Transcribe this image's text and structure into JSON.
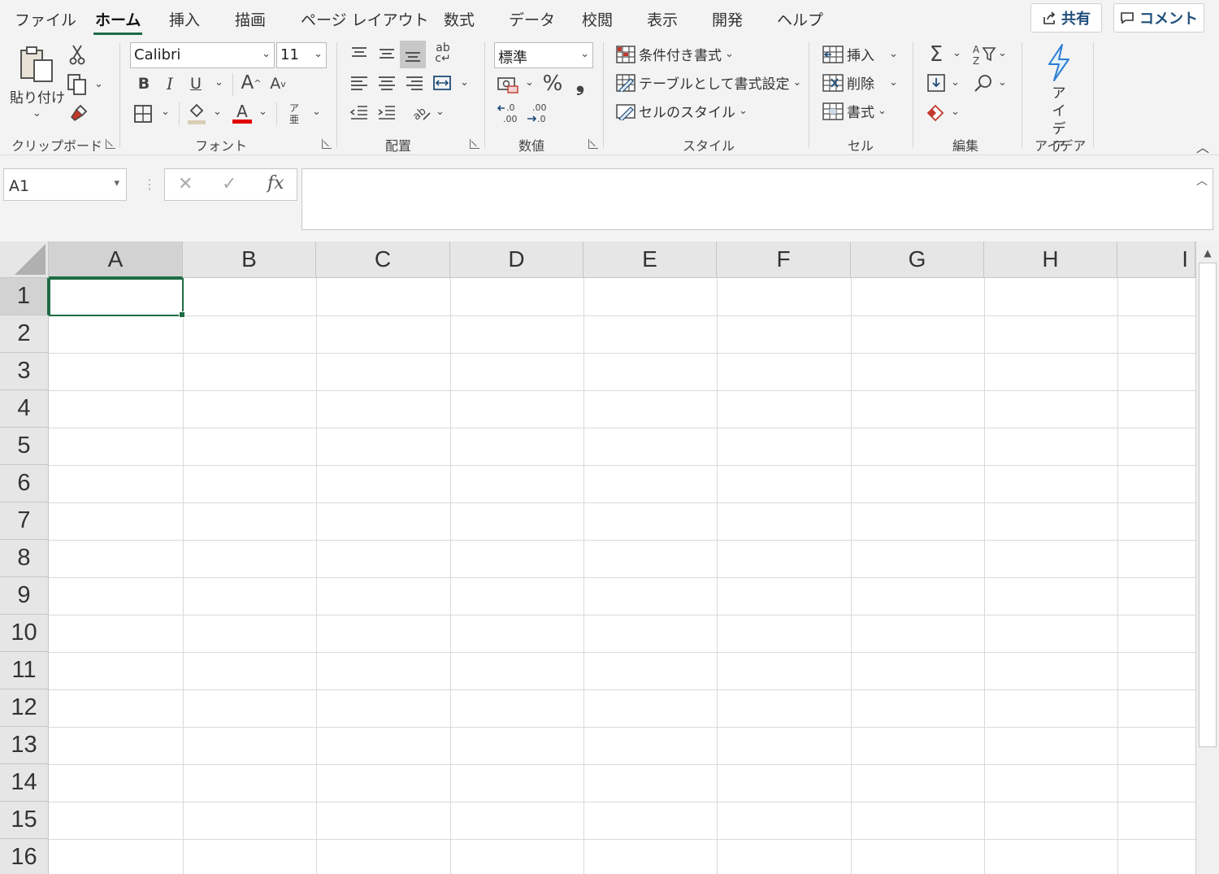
{
  "menu": {
    "tabs": [
      "ファイル",
      "ホーム",
      "挿入",
      "描画",
      "ページ レイアウト",
      "数式",
      "データ",
      "校閲",
      "表示",
      "開発",
      "ヘルプ"
    ],
    "active": "ホーム",
    "share_label": "共有",
    "comment_label": "コメント"
  },
  "ribbon": {
    "clipboard": {
      "paste_label": "貼り付け",
      "group_label": "クリップボード"
    },
    "font": {
      "font_name": "Calibri",
      "font_size": "11",
      "bold": "B",
      "italic": "I",
      "underline": "U",
      "grow": "A",
      "shrink": "A",
      "font_color_glyph": "A",
      "phonetic_top": "ア",
      "phonetic_bottom": "亜",
      "group_label": "フォント"
    },
    "alignment": {
      "group_label": "配置"
    },
    "number": {
      "format": "標準",
      "percent": "%",
      "comma": "❟",
      "inc_decimal": ".0​.00",
      "group_label": "数値"
    },
    "styles": {
      "conditional": "条件付き書式",
      "table": "テーブルとして書式設定",
      "cell_styles": "セルのスタイル",
      "group_label": "スタイル"
    },
    "cells": {
      "insert": "挿入",
      "delete": "削除",
      "format": "書式",
      "group_label": "セル"
    },
    "editing": {
      "group_label": "編集"
    },
    "ideas": {
      "label_line1": "アイ",
      "label_line2": "デア",
      "group_label": "アイデア"
    }
  },
  "formula_bar": {
    "name_box": "A1",
    "fx": "fx",
    "formula": ""
  },
  "grid": {
    "columns": [
      "A",
      "B",
      "C",
      "D",
      "E",
      "F",
      "G",
      "H",
      "I"
    ],
    "rows": [
      "1",
      "2",
      "3",
      "4",
      "5",
      "6",
      "7",
      "8",
      "9",
      "10",
      "11",
      "12",
      "13",
      "14",
      "15",
      "16"
    ],
    "selected_cell": "A1"
  }
}
